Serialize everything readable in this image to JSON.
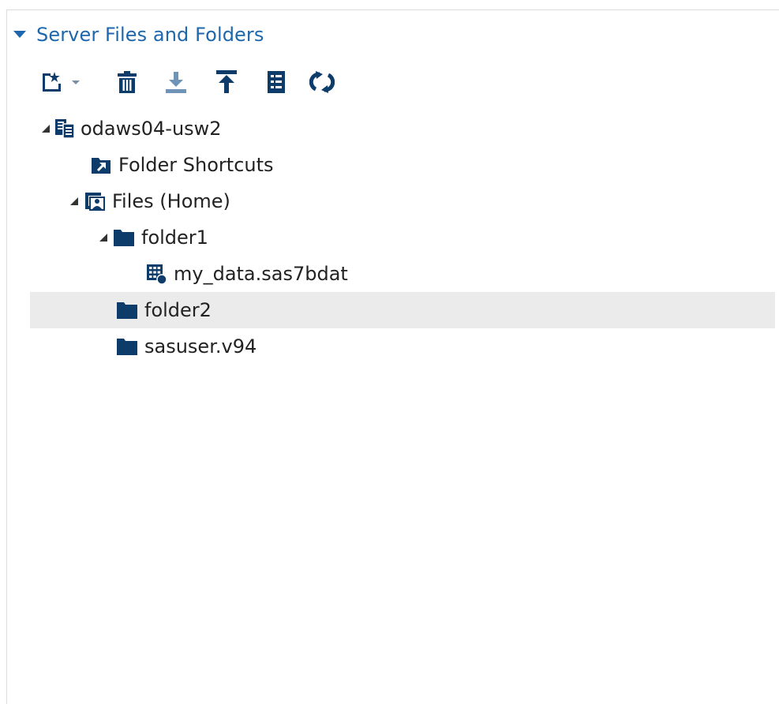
{
  "panel": {
    "title": "Server Files and Folders"
  },
  "toolbar": {
    "buttons": [
      {
        "id": "new",
        "icon": "new-item-icon"
      },
      {
        "id": "delete",
        "icon": "trash-icon"
      },
      {
        "id": "download",
        "icon": "download-icon"
      },
      {
        "id": "upload",
        "icon": "upload-icon"
      },
      {
        "id": "properties",
        "icon": "properties-icon"
      },
      {
        "id": "refresh",
        "icon": "refresh-icon"
      }
    ]
  },
  "tree": {
    "selected": "folder2",
    "nodes": [
      {
        "label": "odaws04-usw2",
        "icon": "server-icon",
        "expanded": true
      },
      {
        "label": "Folder Shortcuts",
        "icon": "folder-shortcut-icon"
      },
      {
        "label": "Files (Home)",
        "icon": "home-files-icon",
        "expanded": true
      },
      {
        "label": "folder1",
        "icon": "folder-icon",
        "expanded": true
      },
      {
        "label": "my_data.sas7bdat",
        "icon": "dataset-icon"
      },
      {
        "label": "folder2",
        "icon": "folder-icon"
      },
      {
        "label": "sasuser.v94",
        "icon": "folder-icon"
      }
    ]
  },
  "colors": {
    "accent": "#1d67ad",
    "icon": "#0e3c6a",
    "selection": "#ebebeb"
  }
}
